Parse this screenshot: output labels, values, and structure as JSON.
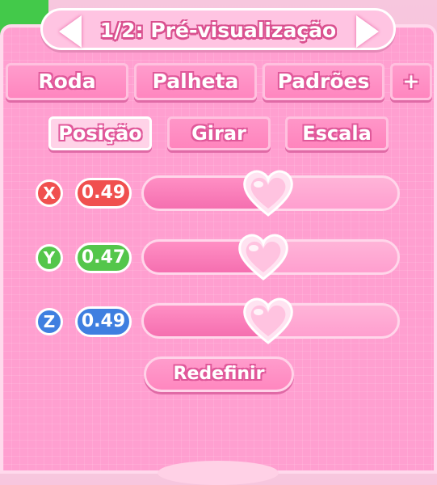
{
  "title": "1/2: Pré-visualização",
  "tabs": [
    {
      "label": "Roda"
    },
    {
      "label": "Palheta"
    },
    {
      "label": "Padrões"
    },
    {
      "label": "+"
    }
  ],
  "subtabs": [
    {
      "label": "Posição",
      "active": true
    },
    {
      "label": "Girar",
      "active": false
    },
    {
      "label": "Escala",
      "active": false
    }
  ],
  "sliders": [
    {
      "axis": "X",
      "value_text": "0.49",
      "value": 0.49,
      "color": "#f0504f"
    },
    {
      "axis": "Y",
      "value_text": "0.47",
      "value": 0.47,
      "color": "#54c64b"
    },
    {
      "axis": "Z",
      "value_text": "0.49",
      "value": 0.49,
      "color": "#3f7fe0"
    }
  ],
  "reset_label": "Redefinir",
  "colors": {
    "panel": "#ff9fd0",
    "accent": "#e0589a"
  }
}
